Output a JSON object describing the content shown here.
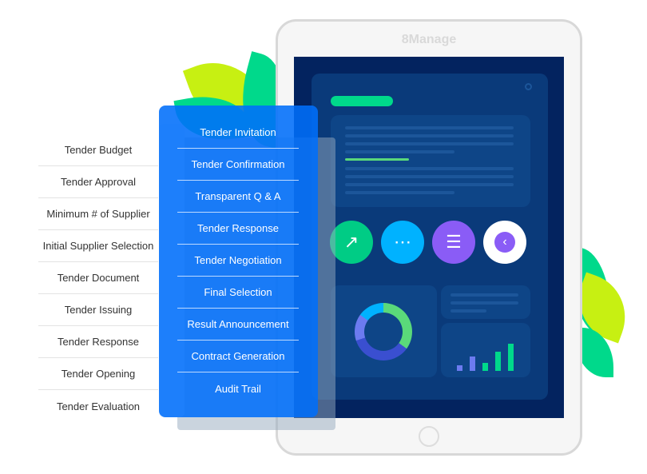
{
  "left_list": {
    "items": [
      "Tender Budget",
      "Tender Approval",
      "Minimum # of Supplier",
      "Initial Supplier Selection",
      "Tender Document",
      "Tender Issuing",
      "Tender Response",
      "Tender Opening",
      "Tender Evaluation"
    ]
  },
  "panel": {
    "items": [
      "Tender Invitation",
      "Tender Confirmation",
      "Transparent Q & A",
      "Tender Response",
      "Tender Negotiation",
      "Final Selection",
      "Result Announcement",
      "Contract Generation",
      "Audit Trail"
    ]
  },
  "tablet": {
    "brand": "8Manage",
    "icons": [
      "chart-growth-icon",
      "chat-icon",
      "checklist-icon",
      "back-icon"
    ]
  },
  "colors": {
    "panel": "#0a74ff",
    "screen": "#03235f",
    "green": "#00d98b",
    "cyan": "#00b2ff",
    "purple": "#8a5cf6",
    "leaf_lime": "#c7f012"
  }
}
